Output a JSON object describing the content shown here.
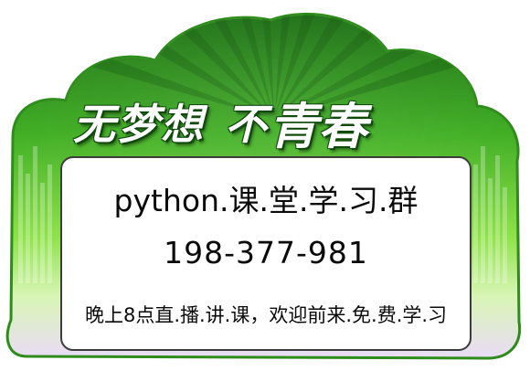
{
  "banner": {
    "slogan_part1": "无梦想",
    "slogan_part2": "不",
    "slogan_part3": "青春"
  },
  "card": {
    "group_title": "python.课.堂.学.习.群",
    "group_number": "198-377-981",
    "schedule_note": "晚上8点直.播.讲.课，欢迎前来.免.费.学.习"
  },
  "colors": {
    "dark_green": "#1f7a14",
    "bright_green": "#5cd42c",
    "light_green": "#b7f07a",
    "lavender": "#e8dcf6"
  }
}
